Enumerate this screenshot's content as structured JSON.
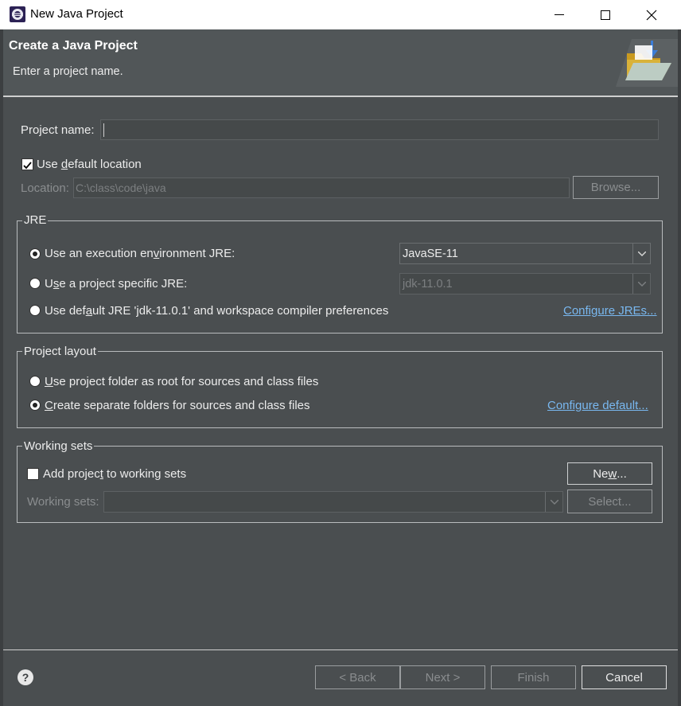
{
  "window": {
    "title": "New Java Project"
  },
  "banner": {
    "title": "Create a Java Project",
    "subtitle": "Enter a project name."
  },
  "project": {
    "name_label": "Project name:",
    "name_value": "",
    "use_default_location_label_pre": "Use ",
    "use_default_location_label_mnemonic": "d",
    "use_default_location_label_post": "efault location",
    "use_default_location_checked": true,
    "location_label": "Location:",
    "location_value": "C:\\class\\code\\java",
    "browse_label": "Browse..."
  },
  "jre": {
    "group_title": "JRE",
    "option_env_pre": "Use an execution en",
    "option_env_mnemonic": "v",
    "option_env_post": "ironment JRE:",
    "option_env_value": "JavaSE-11",
    "option_specific_pre": "U",
    "option_specific_mnemonic": "s",
    "option_specific_post": "e a project specific JRE:",
    "option_specific_value": "jdk-11.0.1",
    "option_default_pre": "Use def",
    "option_default_mnemonic": "a",
    "option_default_post": "ult JRE 'jdk-11.0.1' and workspace compiler preferences",
    "configure_jres_link": "Configure JREs..."
  },
  "layout": {
    "group_title": "Project layout",
    "option_root_pre": "",
    "option_root_mnemonic": "U",
    "option_root_post": "se project folder as root for sources and class files",
    "option_separate_pre": "",
    "option_separate_mnemonic": "C",
    "option_separate_post": "reate separate folders for sources and class files",
    "configure_default_link": "Configure default..."
  },
  "working_sets": {
    "group_title": "Working sets",
    "add_label_pre": "Add projec",
    "add_label_mnemonic": "t",
    "add_label_post": " to working sets",
    "add_checked": false,
    "new_button_pre": "Ne",
    "new_button_mnemonic": "w",
    "new_button_post": "...",
    "working_sets_label": "Working sets:",
    "working_sets_value": "",
    "select_button": "Select..."
  },
  "footer": {
    "help_glyph": "?",
    "back_button": "< Back",
    "next_button": "Next >",
    "finish_button": "Finish",
    "cancel_button": "Cancel"
  },
  "colors": {
    "pane_background": "#4a4e50",
    "banner_background": "#515658",
    "link": "#79b8f0"
  }
}
